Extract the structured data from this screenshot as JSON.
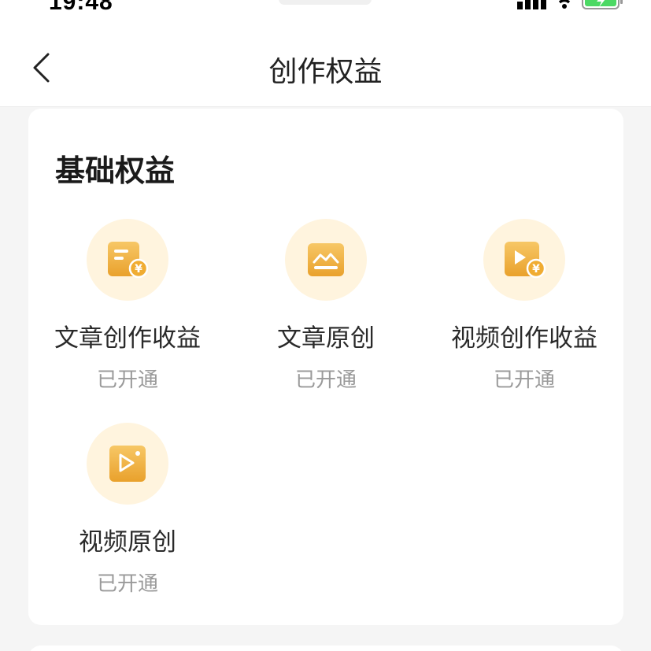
{
  "status_bar": {
    "time": "19:48"
  },
  "navbar": {
    "title": "创作权益",
    "back_icon": "chevron-left-icon"
  },
  "section": {
    "title": "基础权益",
    "items": [
      {
        "label": "文章创作收益",
        "status": "已开通",
        "icon": "article-revenue-icon"
      },
      {
        "label": "文章原创",
        "status": "已开通",
        "icon": "article-original-icon"
      },
      {
        "label": "视频创作收益",
        "status": "已开通",
        "icon": "video-revenue-icon"
      },
      {
        "label": "视频原创",
        "status": "已开通",
        "icon": "video-original-icon"
      }
    ]
  },
  "colors": {
    "accent": "#f2b13a",
    "icon_circle": "#fff4de",
    "status_text": "#9a9a9a"
  }
}
